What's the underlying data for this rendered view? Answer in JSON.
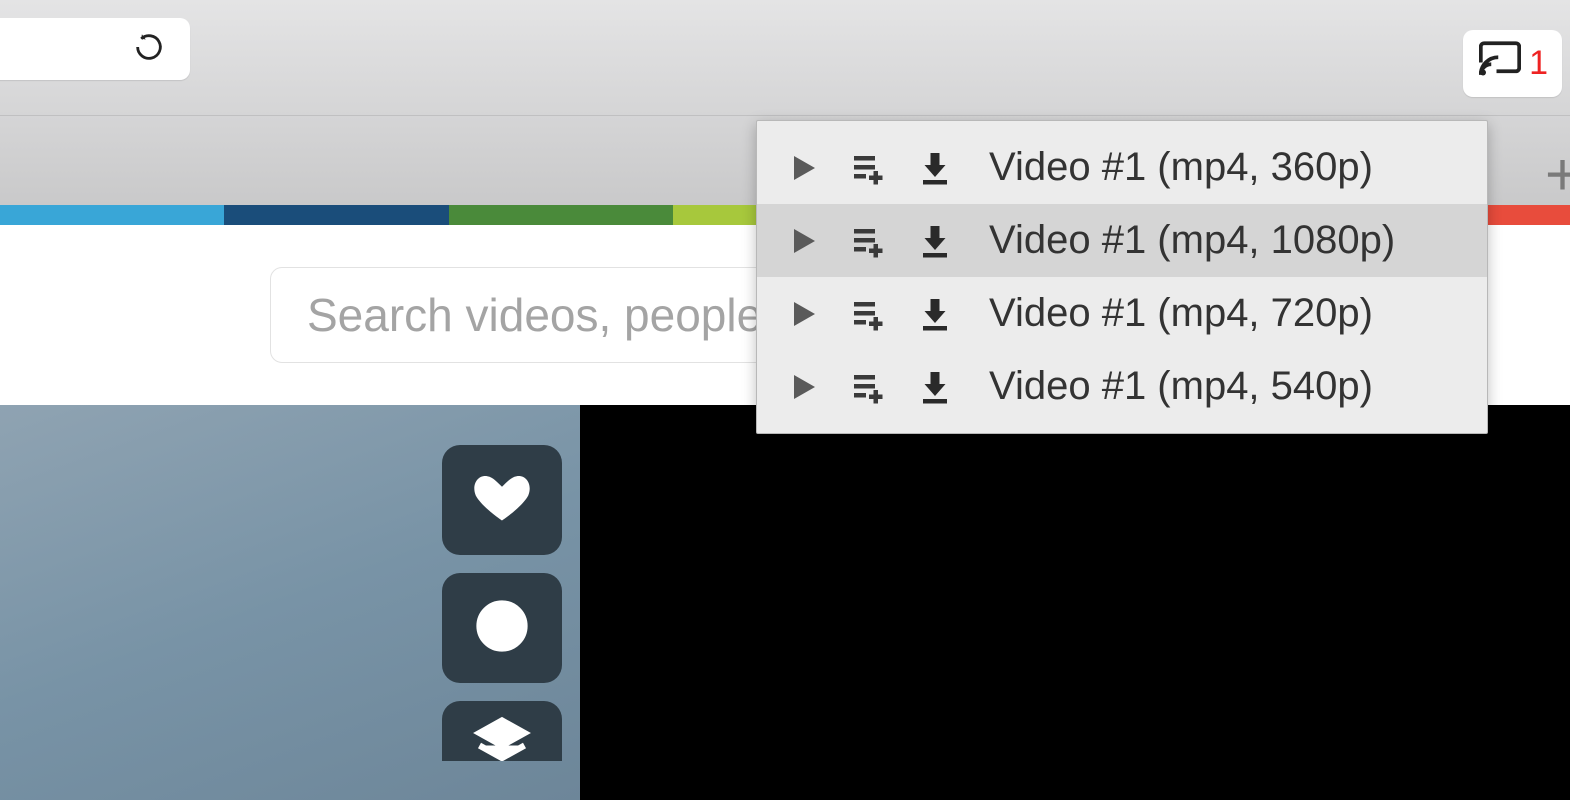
{
  "browser": {
    "cast_badge": "1"
  },
  "search": {
    "placeholder": "Search videos, people"
  },
  "rainbow_colors": [
    "#39a6d7",
    "#1a4d7a",
    "#4a8a3a",
    "#a7c83c",
    "#f0d23c",
    "#f08a2c",
    "#e84c3c"
  ],
  "dropdown": {
    "items": [
      {
        "label": "Video #1 (mp4, 360p)"
      },
      {
        "label": "Video #1 (mp4, 1080p)"
      },
      {
        "label": "Video #1 (mp4, 720p)"
      },
      {
        "label": "Video #1 (mp4, 540p)"
      }
    ],
    "hover_index": 1
  }
}
